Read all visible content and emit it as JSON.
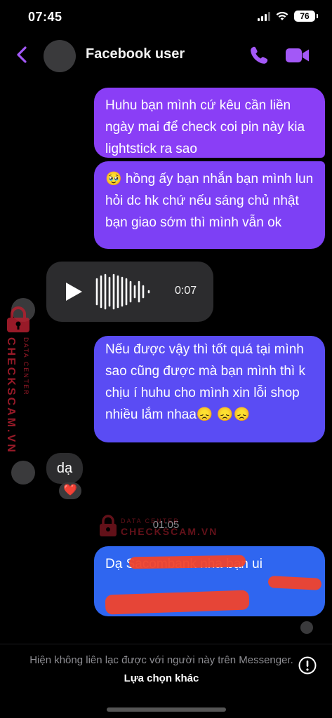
{
  "status_bar": {
    "time": "07:45",
    "battery": "76"
  },
  "header": {
    "title": "Facebook user",
    "back_icon": "chevron-left",
    "call_icon": "phone",
    "video_icon": "video-camera",
    "accent_color": "#a358f7"
  },
  "messages": {
    "outgoing_1": "Huhu bạn mình cứ kêu cần liền ngày mai để check coi pin này kia lightstick ra sao",
    "outgoing_2": "🥹 hồng ấy bạn nhắn bạn mình lun hỏi dc hk chứ nếu sáng chủ nhật bạn giao sớm thì mình vẫn ok",
    "audio": {
      "duration": "0:07"
    },
    "outgoing_3": "Nếu được vậy thì tốt quá tại mình sao cũng được mà bạn mình thì k chịu í huhu cho mình xin lỗi shop nhiều lắm nhaa😞 😞😞",
    "incoming_1": "dạ",
    "incoming_1_reaction": "❤️",
    "timestamp": "01:05",
    "outgoing_4": "Dạ Sacombank nha bạn ui"
  },
  "watermark": {
    "brand": "CHECKSCAM.VN",
    "sub": "DATA CENTER"
  },
  "footer": {
    "notice": "Hiện không liên lạc được với người này trên Messenger.",
    "link": "Lựa chọn khác"
  },
  "colors": {
    "background": "#000000",
    "bubble_purple": "#8a3ef6",
    "bubble_blue": "#2f66f0",
    "incoming_bubble": "#2c2c2e",
    "redaction": "#f0432c"
  }
}
